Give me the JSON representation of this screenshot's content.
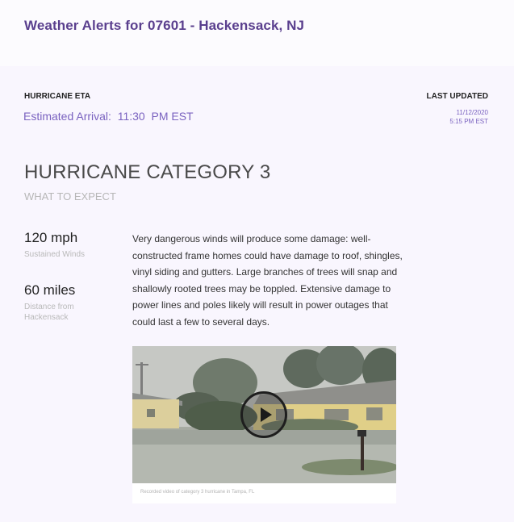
{
  "header": {
    "title": "Weather Alerts for 07601 - Hackensack, NJ"
  },
  "eta": {
    "label": "HURRICANE ETA",
    "value": "Estimated Arrival:  11:30  PM EST"
  },
  "updated": {
    "label": "LAST UPDATED",
    "date": "11/12/2020",
    "time": "5:15 PM EST"
  },
  "category": {
    "heading": "HURRICANE CATEGORY 3",
    "subheading": "WHAT TO EXPECT"
  },
  "stats": {
    "wind_value": "120 mph",
    "wind_caption": "Sustained Winds",
    "distance_value": "60 miles",
    "distance_caption": "Distance from Hackensack"
  },
  "description": "Very dangerous winds will produce some damage: well-constructed frame homes could have damage to roof, shingles, vinyl siding and gutters. Large branches of trees will snap and shallowly rooted trees may be toppled. Extensive damage to power lines and poles likely will result in power outages that could last a few to several days.",
  "video": {
    "caption": "Recorded video of category 3 hurricane in Tampa, FL",
    "play_icon": "play-icon"
  },
  "colors": {
    "accent": "#5a3f8e",
    "accent_light": "#7a62c0",
    "background": "#f9f6fe"
  }
}
